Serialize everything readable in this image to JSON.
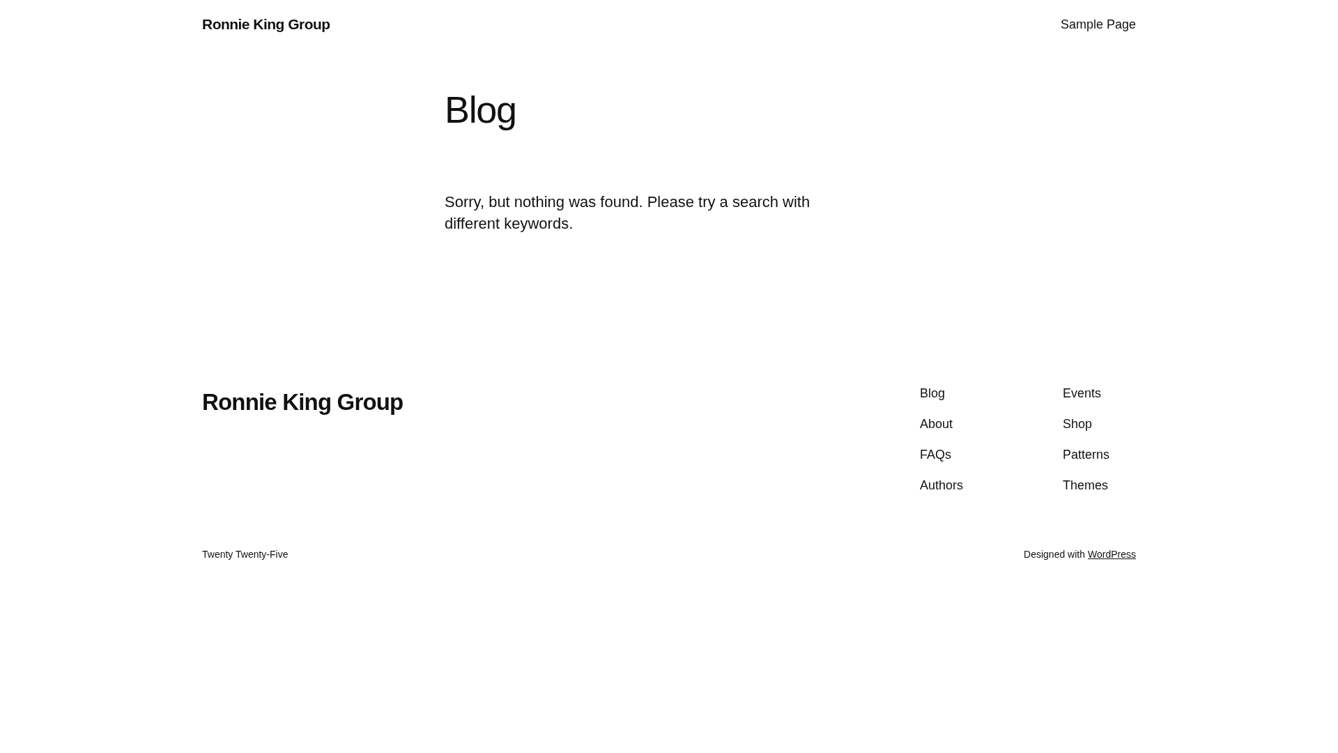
{
  "header": {
    "site_title": "Ronnie King Group",
    "nav": [
      "Sample Page"
    ]
  },
  "main": {
    "title": "Blog",
    "message": "Sorry, but nothing was found. Please try a search with different keywords."
  },
  "footer": {
    "site_title": "Ronnie King Group",
    "nav_columns": [
      [
        "Blog",
        "About",
        "FAQs",
        "Authors"
      ],
      [
        "Events",
        "Shop",
        "Patterns",
        "Themes"
      ]
    ],
    "theme_name": "Twenty Twenty-Five",
    "credit_prefix": "Designed with",
    "credit_link": "WordPress"
  }
}
